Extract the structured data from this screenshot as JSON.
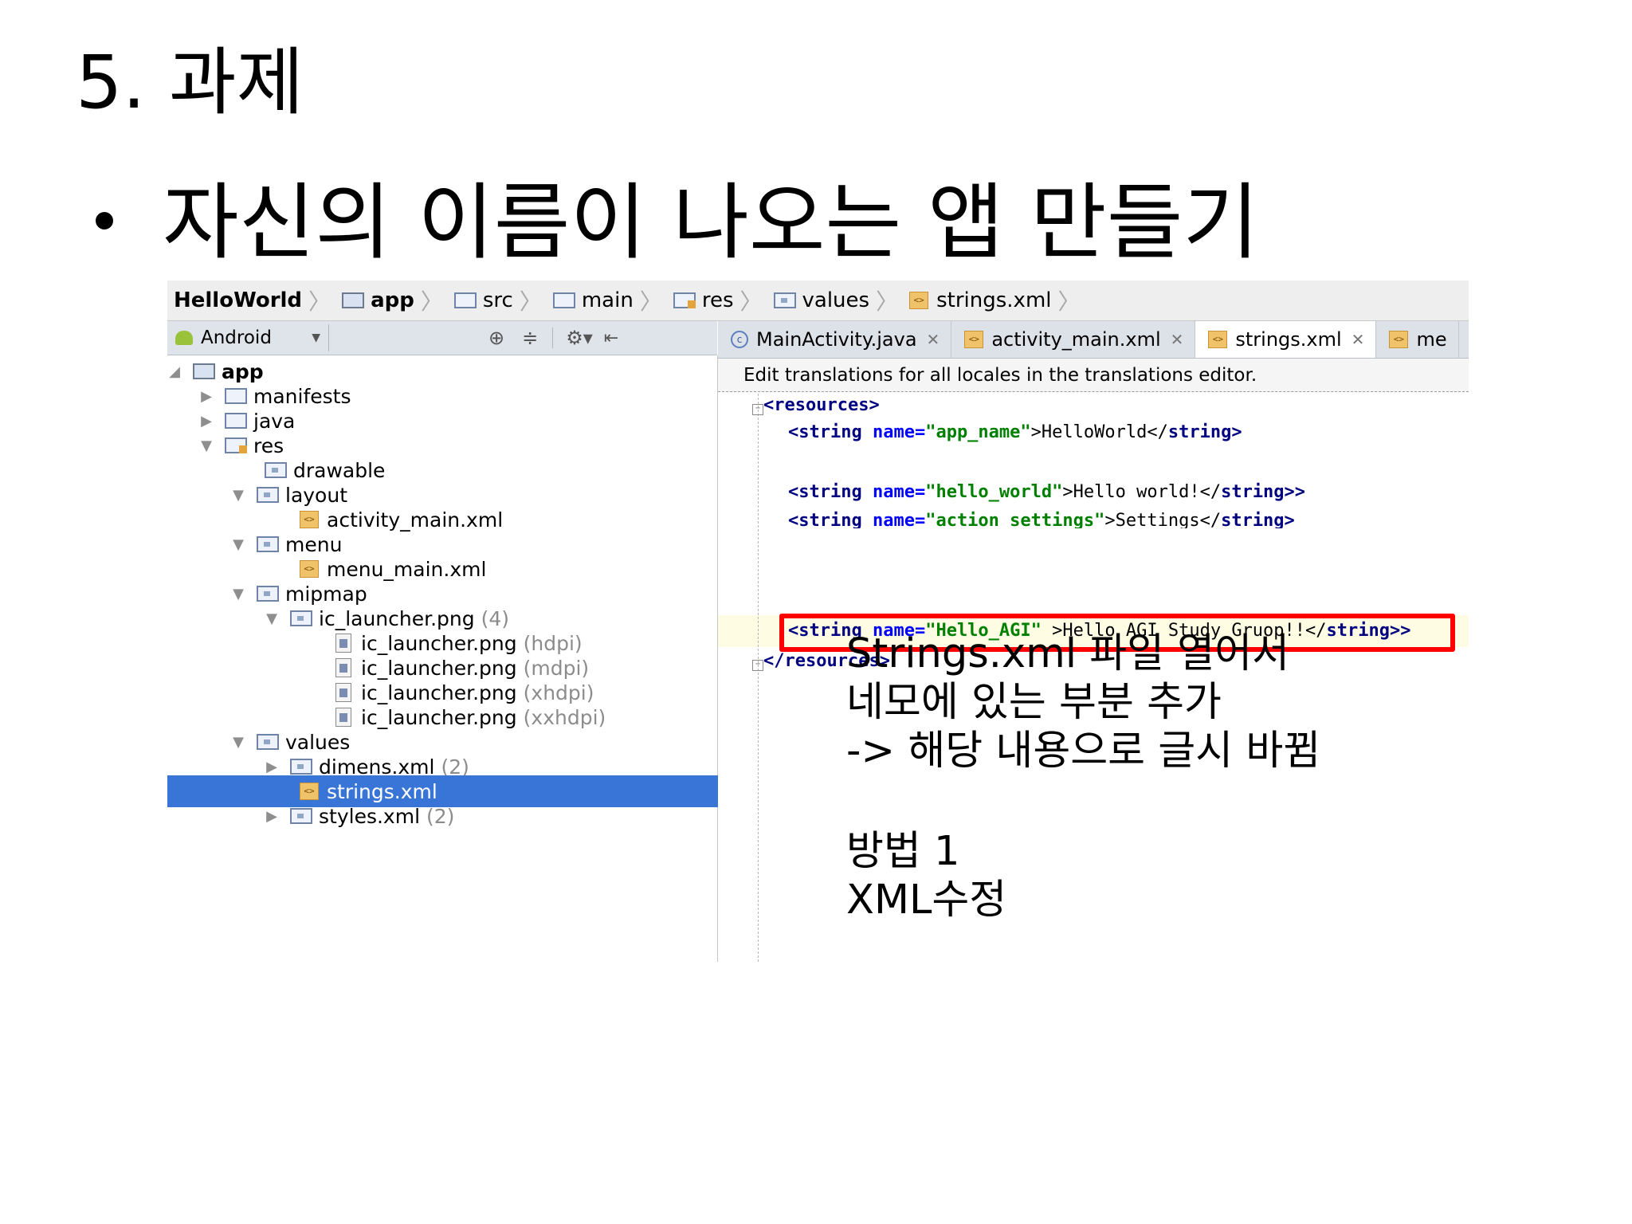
{
  "slide": {
    "title": "5. 과제",
    "bullet": "자신의 이름이 나오는 앱 만들기"
  },
  "breadcrumb": [
    "HelloWorld",
    "app",
    "src",
    "main",
    "res",
    "values",
    "strings.xml"
  ],
  "project_panel": {
    "view_selector": "Android",
    "icons": [
      "target-icon",
      "collapse-all-icon",
      "gear-icon",
      "hide-panel-icon"
    ],
    "tree": [
      {
        "label": "app",
        "depth": 0,
        "expanded": true
      },
      {
        "label": "manifests",
        "depth": 1,
        "expanded": false
      },
      {
        "label": "java",
        "depth": 1,
        "expanded": false
      },
      {
        "label": "res",
        "depth": 1,
        "expanded": true
      },
      {
        "label": "drawable",
        "depth": 2
      },
      {
        "label": "layout",
        "depth": 2,
        "expanded": true
      },
      {
        "label": "activity_main.xml",
        "depth": 3
      },
      {
        "label": "menu",
        "depth": 2,
        "expanded": true
      },
      {
        "label": "menu_main.xml",
        "depth": 3
      },
      {
        "label": "mipmap",
        "depth": 2,
        "expanded": true
      },
      {
        "label": "ic_launcher.png",
        "hint": "(4)",
        "depth": 3,
        "expanded": true
      },
      {
        "label": "ic_launcher.png",
        "hint": "(hdpi)",
        "depth": 4
      },
      {
        "label": "ic_launcher.png",
        "hint": "(mdpi)",
        "depth": 4
      },
      {
        "label": "ic_launcher.png",
        "hint": "(xhdpi)",
        "depth": 4
      },
      {
        "label": "ic_launcher.png",
        "hint": "(xxhdpi)",
        "depth": 4
      },
      {
        "label": "values",
        "depth": 2,
        "expanded": true
      },
      {
        "label": "dimens.xml",
        "hint": "(2)",
        "depth": 3,
        "expanded": false
      },
      {
        "label": "strings.xml",
        "depth": 3,
        "selected": true
      },
      {
        "label": "styles.xml",
        "hint": "(2)",
        "depth": 3,
        "expanded": false
      }
    ]
  },
  "tabs": [
    {
      "label": "MainActivity.java",
      "icon": "c"
    },
    {
      "label": "activity_main.xml",
      "icon": "<>"
    },
    {
      "label": "strings.xml",
      "icon": "<>",
      "active": true
    },
    {
      "label": "me",
      "icon": "<>"
    }
  ],
  "editor": {
    "notice": "Edit translations for all locales in the translations editor.",
    "lines": {
      "open": "<resources>",
      "l1_open": "<string ",
      "l1_attr": "name=",
      "l1_val": "\"app_name\"",
      "l1_text": ">HelloWorld</",
      "l1_close": "string>",
      "l2_open": "<string ",
      "l2_attr": "name=",
      "l2_val": "\"hello_world\"",
      "l2_text": ">Hello world!</",
      "l2_close": "string>>",
      "l3_open": "<string ",
      "l3_attr": "name=",
      "l3_val": "\"action_settings\"",
      "l3_text": ">Settings</",
      "l3_close": "string>",
      "l4_open": "<string ",
      "l4_attr": "name=",
      "l4_val": "\"Hello_AGI\"",
      "l4_text": " >Hello AGI Study Gruop!!</",
      "l4_close": "string>>",
      "close": "</resources>"
    },
    "highlight_color": "#ff0000"
  },
  "notes": {
    "line1": "Strings.xml 파일 열어서",
    "line2": "네모에 있는 부분 추가",
    "line3": "-> 해당 내용으로 글시 바뀜",
    "line4": "방법 1",
    "line5": "XML수정"
  }
}
